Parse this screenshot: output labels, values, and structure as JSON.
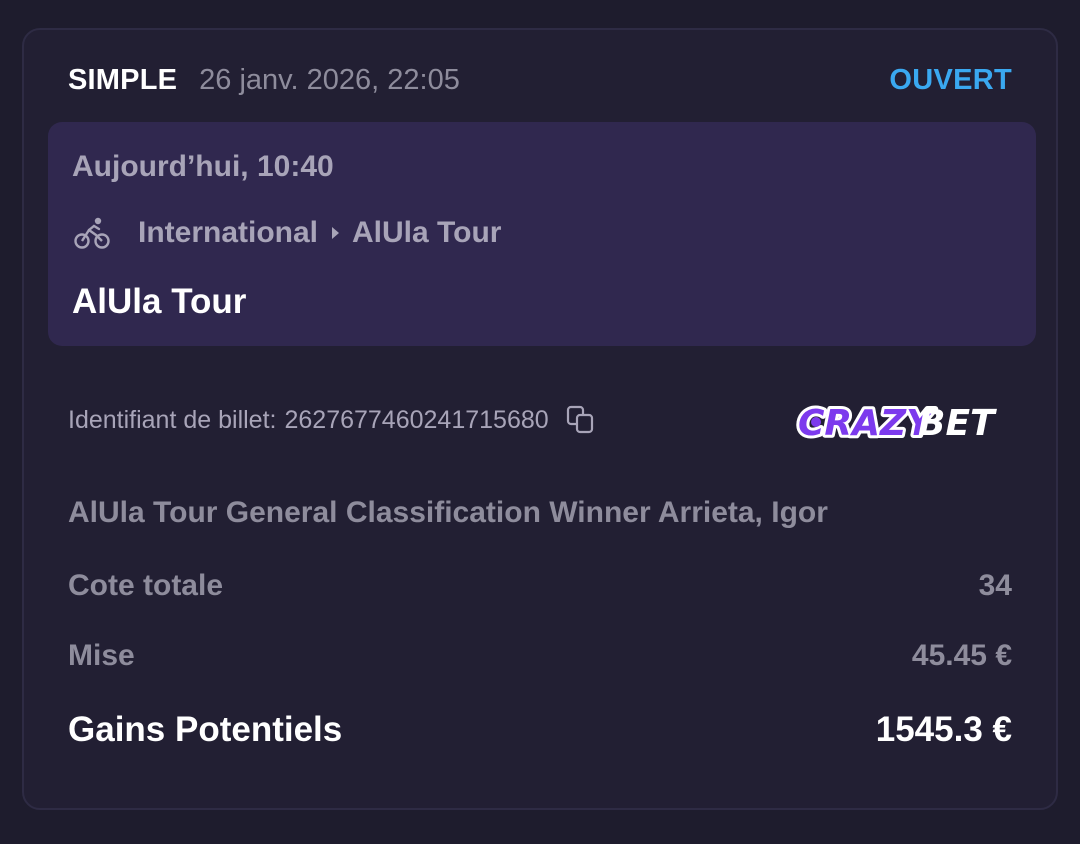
{
  "bet": {
    "type": "SIMPLE",
    "placed_at": "26 janv. 2026, 22:05",
    "status": "OUVERT"
  },
  "event": {
    "time": "Aujourd’hui, 10:40",
    "sport_icon": "bicycle-icon",
    "category": "International",
    "competition": "AlUla Tour",
    "name": "AlUla Tour"
  },
  "ticket": {
    "label": "Identifiant de billet:",
    "id": "2627677460241715680",
    "copy_icon": "copy-icon"
  },
  "brand": {
    "name": "CRAZYBET",
    "colors": {
      "crazy": "#7c3aed",
      "bet": "#ffffff"
    }
  },
  "selection": "AlUla Tour General Classification Winner Arrieta, Igor",
  "summary": {
    "odds_label": "Cote totale",
    "odds_value": "34",
    "stake_label": "Mise",
    "stake_value": "45.45 €",
    "payout_label": "Gains Potentiels",
    "payout_value": "1545.3 €"
  },
  "colors": {
    "background": "#1e1c2d",
    "card": "#221f33",
    "event_box": "#30284f",
    "status_open": "#3aa8f0",
    "muted_text": "#8e8c9c"
  }
}
